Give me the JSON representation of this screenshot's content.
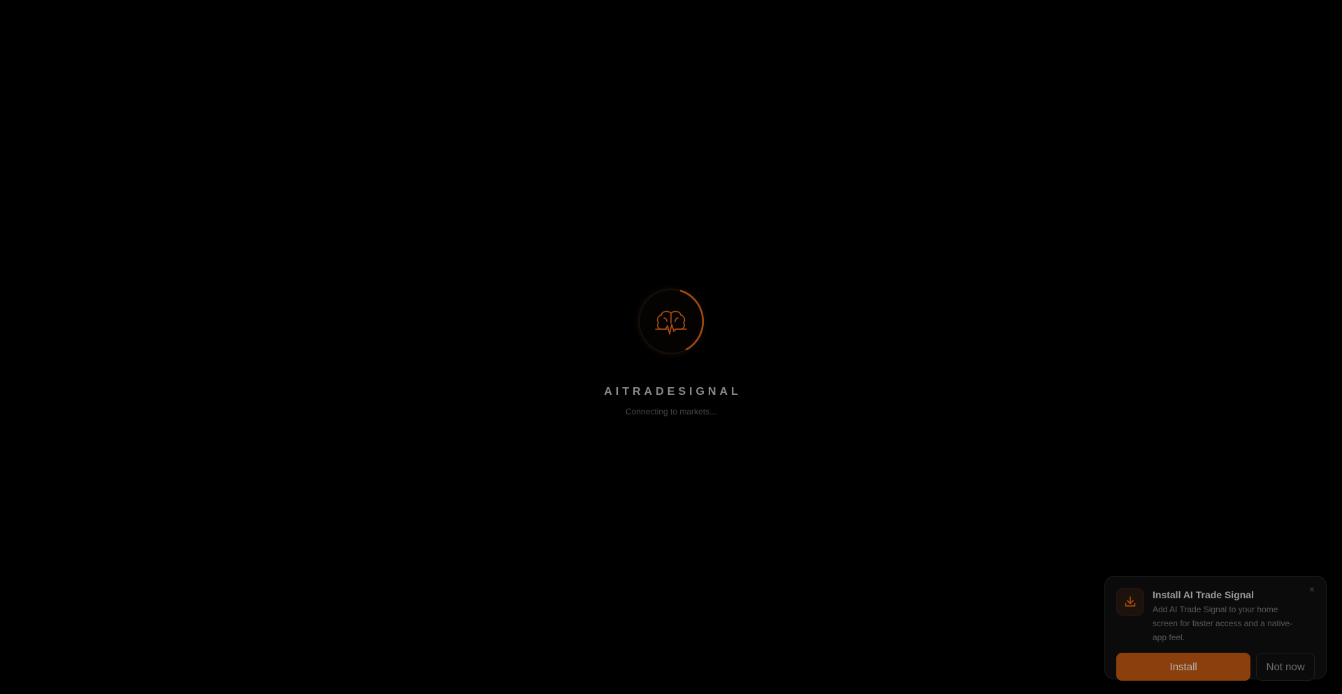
{
  "loader": {
    "brand": "AITRADESIGNAL",
    "status": "Connecting to markets...",
    "icon": "brain-pulse-icon",
    "accent_color": "#c2540f"
  },
  "install_prompt": {
    "icon": "download-icon",
    "title": "Install AI Trade Signal",
    "description": "Add AI Trade Signal to your home screen for faster access and a native-app feel.",
    "install_label": "Install",
    "dismiss_label": "Not now",
    "close_icon": "close-icon",
    "close_glyph": "×",
    "accent_color": "#8a3f0c"
  }
}
